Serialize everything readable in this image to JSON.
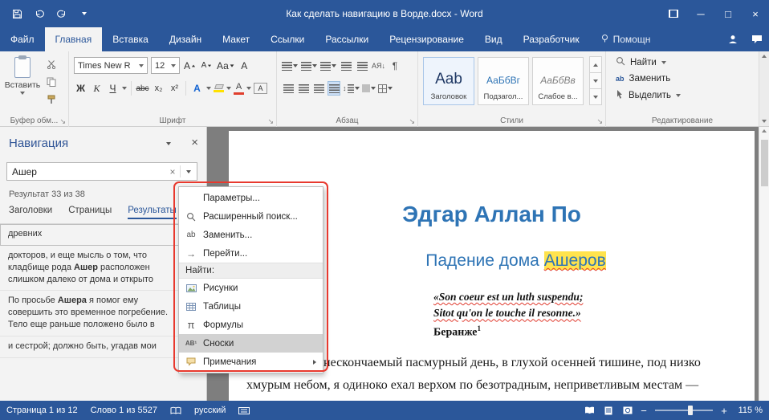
{
  "titlebar": {
    "title": "Как сделать навигацию в Ворде.docx - Word"
  },
  "tabs": {
    "file": "Файл",
    "items": [
      "Главная",
      "Вставка",
      "Дизайн",
      "Макет",
      "Ссылки",
      "Рассылки",
      "Рецензирование",
      "Вид",
      "Разработчик"
    ],
    "helper": "Помощн"
  },
  "ribbon": {
    "clipboard": {
      "paste": "Вставить",
      "label": "Буфер обм..."
    },
    "font": {
      "label": "Шрифт",
      "name": "Times New R",
      "size": "12",
      "grow": "А",
      "shrink": "А",
      "case_btn": "Аа",
      "bold": "Ж",
      "italic": "К",
      "underline": "Ч",
      "strike": "abc",
      "subscript": "x₂",
      "superscript": "x²",
      "effects": "А",
      "color_letter": "А",
      "shade_letter": "А"
    },
    "paragraph": {
      "label": "Абзац",
      "sort": "АЯ↓",
      "pilcrow": "¶",
      "spacing": "↕"
    },
    "styles": {
      "label": "Стили",
      "items": [
        {
          "preview": "Aab",
          "name": "Заголовок"
        },
        {
          "preview": "АаБбВг",
          "name": "Подзагол..."
        },
        {
          "preview": "АаБбВв",
          "name": "Слабое в..."
        }
      ]
    },
    "editing": {
      "label": "Редактирование",
      "find": "Найти",
      "replace": "Заменить",
      "select": "Выделить",
      "replace_icon": "ab"
    }
  },
  "nav": {
    "title": "Навигация",
    "search_value": "Ашер",
    "result_count": "Результат 33 из 38",
    "tabs": [
      "Заголовки",
      "Страницы",
      "Результаты"
    ],
    "results": [
      {
        "pre": "древних",
        "bold": "",
        "post": ""
      },
      {
        "pre": "докторов, и еще мысль о том, что кладбище рода ",
        "bold": "Ашер",
        "post": " расположен слишком далеко от дома и открыто"
      },
      {
        "pre": "По просьбе ",
        "bold": "Ашера",
        "post": " я помог ему совершить это временное погребение. Тело еще раньше положено было в"
      },
      {
        "pre": "и сестрой; должно быть, угадав мои",
        "bold": "",
        "post": ""
      }
    ]
  },
  "menu": {
    "options": "Параметры...",
    "advanced_find": "Расширенный поиск...",
    "replace": "Заменить...",
    "goto": "Перейти...",
    "find_header": "Найти:",
    "graphics": "Рисунки",
    "tables": "Таблицы",
    "equations": "Формулы",
    "footnotes": "Сноски",
    "comments": "Примечания",
    "replace_icon": "ab",
    "goto_icon": "→",
    "pi_icon": "π",
    "footnote_icon": "AB¹"
  },
  "document": {
    "title": "Эдгар Аллан По",
    "subtitle_pre": "Падение дома ",
    "subtitle_match": "Ашеров",
    "quote_line1": "«Son coeur est un luth suspendu;",
    "quote_line2": "Sitot qu'on le touche il resonne.»",
    "quote_author": "Беранже",
    "footnote_ref": "1",
    "body_line1": "нескончаемый пасмурный день, в глухой осенней тишине, под низко",
    "body_line2": "хмурым небом, я одиноко ехал верхом по безотрадным, неприветливым местам —"
  },
  "statusbar": {
    "page": "Страница 1 из 12",
    "words": "Слово 1 из 5527",
    "language": "русский",
    "zoom": "115 %"
  },
  "icons": {
    "close": "×",
    "minimize": "─",
    "maximize": "□"
  }
}
